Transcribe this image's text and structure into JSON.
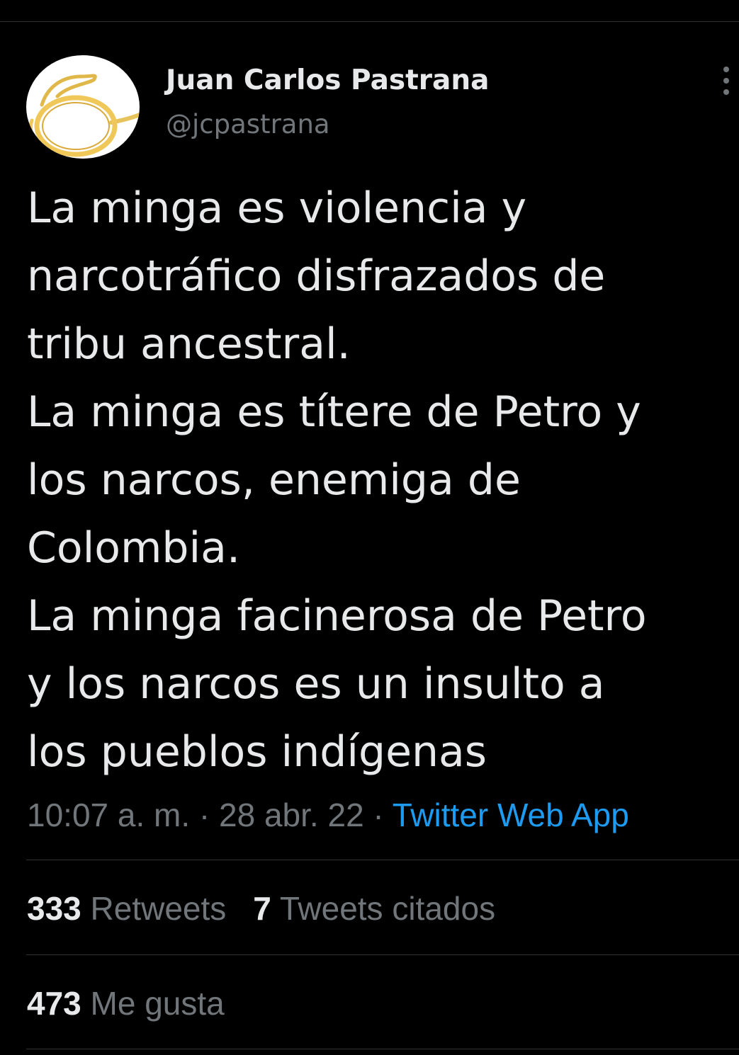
{
  "author": {
    "display_name": "Juan Carlos Pastrana",
    "handle": "@jcpastrana",
    "avatar_icon": "round-glasses-icon"
  },
  "tweet": {
    "lines": [
      "La minga es violencia y",
      "narcotráfico disfrazados de",
      "tribu ancestral.",
      "La minga es títere de Petro y",
      "los narcos, enemiga de",
      "Colombia.",
      "La minga facinerosa de Petro",
      "y los narcos es un insulto a",
      "los pueblos indígenas"
    ]
  },
  "meta": {
    "time": "10:07 a. m.",
    "separator": " · ",
    "date": "28 abr. 22",
    "source": "Twitter Web App"
  },
  "stats": {
    "retweets_count": "333",
    "retweets_label": "Retweets",
    "quotes_count": "7",
    "quotes_label": "Tweets citados",
    "likes_count": "473",
    "likes_label": "Me gusta"
  },
  "colors": {
    "background": "#000000",
    "text": "#e7e9ea",
    "secondary_text": "#71767b",
    "link": "#1d9bf0",
    "divider": "#2f3336"
  }
}
